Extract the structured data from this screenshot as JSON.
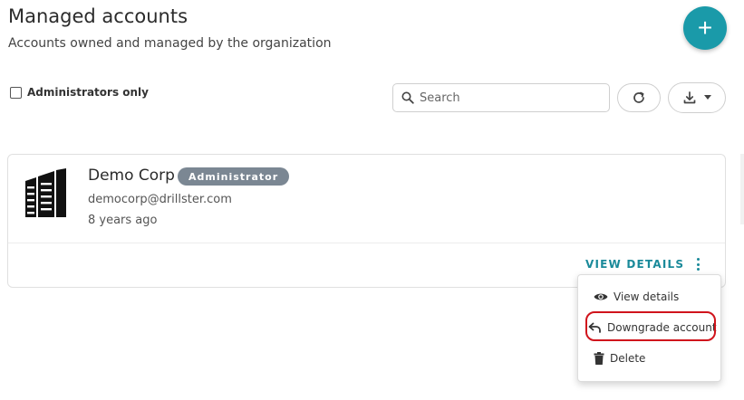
{
  "header": {
    "title": "Managed accounts",
    "subtitle": "Accounts owned and managed by the organization",
    "add_button_label": "+"
  },
  "filters": {
    "admin_only_label": "Administrators only",
    "admin_only_checked": false,
    "search_placeholder": "Search",
    "search_value": ""
  },
  "account": {
    "name": "Demo Corp",
    "role_badge": "Administrator",
    "email": "democorp@drillster.com",
    "age": "8 years ago",
    "logo_icon": "office-building-icon",
    "view_details_label": "VIEW DETAILS"
  },
  "menu": {
    "items": [
      {
        "label": "View details",
        "icon": "eye-icon"
      },
      {
        "label": "Downgrade account",
        "icon": "undo-icon"
      },
      {
        "label": "Delete",
        "icon": "trash-icon"
      }
    ]
  },
  "colors": {
    "accent": "#1a9aa9",
    "badge": "#7b8793",
    "highlight": "#d0141c"
  }
}
